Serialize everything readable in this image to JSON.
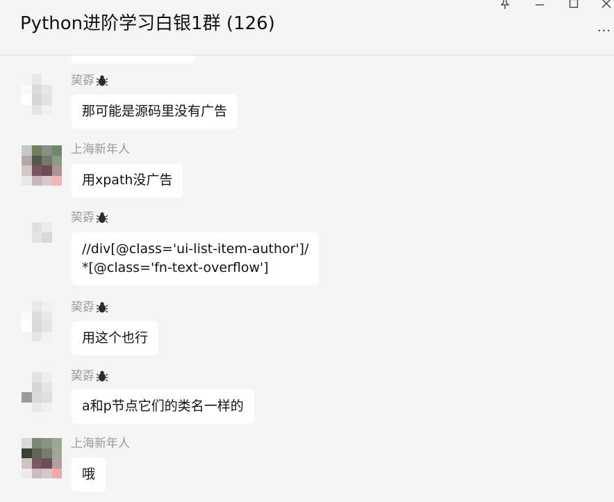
{
  "window": {
    "title": "Python进阶学习白银1群 (126)",
    "controls": [
      "pin",
      "minimize",
      "maximize",
      "close"
    ],
    "more_label": "···"
  },
  "messages": [
    {
      "sender": "巭孬",
      "sender_badge": "bug-icon",
      "text": "那可能是源码里没有广告"
    },
    {
      "sender": "上海新年人",
      "sender_badge": "",
      "text": "用xpath没广告"
    },
    {
      "sender": "巭孬",
      "sender_badge": "bug-icon",
      "text": "//div[@class='ui-list-item-author']/\n*[@class='fn-text-overflow']"
    },
    {
      "sender": "巭孬",
      "sender_badge": "bug-icon",
      "text": "用这个也行"
    },
    {
      "sender": "巭孬",
      "sender_badge": "bug-icon",
      "text": "a和p节点它们的类名一样的"
    },
    {
      "sender": "上海新年人",
      "sender_badge": "",
      "text": "哦"
    }
  ]
}
